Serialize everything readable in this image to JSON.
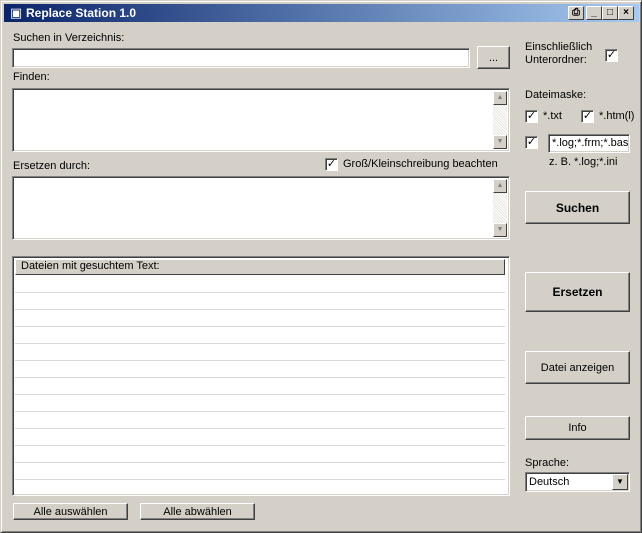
{
  "window": {
    "title": "Replace Station 1.0",
    "buttons": {
      "restore": "⎙",
      "minimize": "_",
      "maximize": "□",
      "close": "×"
    }
  },
  "search_dir": {
    "label": "Suchen in Verzeichnis:",
    "value": "",
    "browse_label": "..."
  },
  "find": {
    "label": "Finden:",
    "value": ""
  },
  "replace": {
    "label": "Ersetzen durch:",
    "value": ""
  },
  "case_sensitive": {
    "label": "Groß/Kleinschreibung beachten",
    "checked": true,
    "mark": "✓"
  },
  "subfolders": {
    "label_line1": "Einschließlich",
    "label_line2": "Unterordner:",
    "checked": true,
    "mark": "✓"
  },
  "file_mask": {
    "label": "Dateimaske:",
    "txt_label": "*.txt",
    "htm_label": "*.htm(l)",
    "custom_value": "*.log;*.frm;*.bas",
    "hint": "z. B. *.log;*.ini",
    "mark": "✓"
  },
  "results": {
    "header": "Dateien mit gesuchtem Text:",
    "rows": [
      "",
      "",
      "",
      "",
      "",
      "",
      "",
      "",
      "",
      "",
      "",
      ""
    ]
  },
  "actions": {
    "search": "Suchen",
    "replace": "Ersetzen",
    "show_file": "Datei anzeigen",
    "info": "Info",
    "select_all": "Alle auswählen",
    "deselect_all": "Alle abwählen"
  },
  "language": {
    "label": "Sprache:",
    "selected": "Deutsch"
  }
}
